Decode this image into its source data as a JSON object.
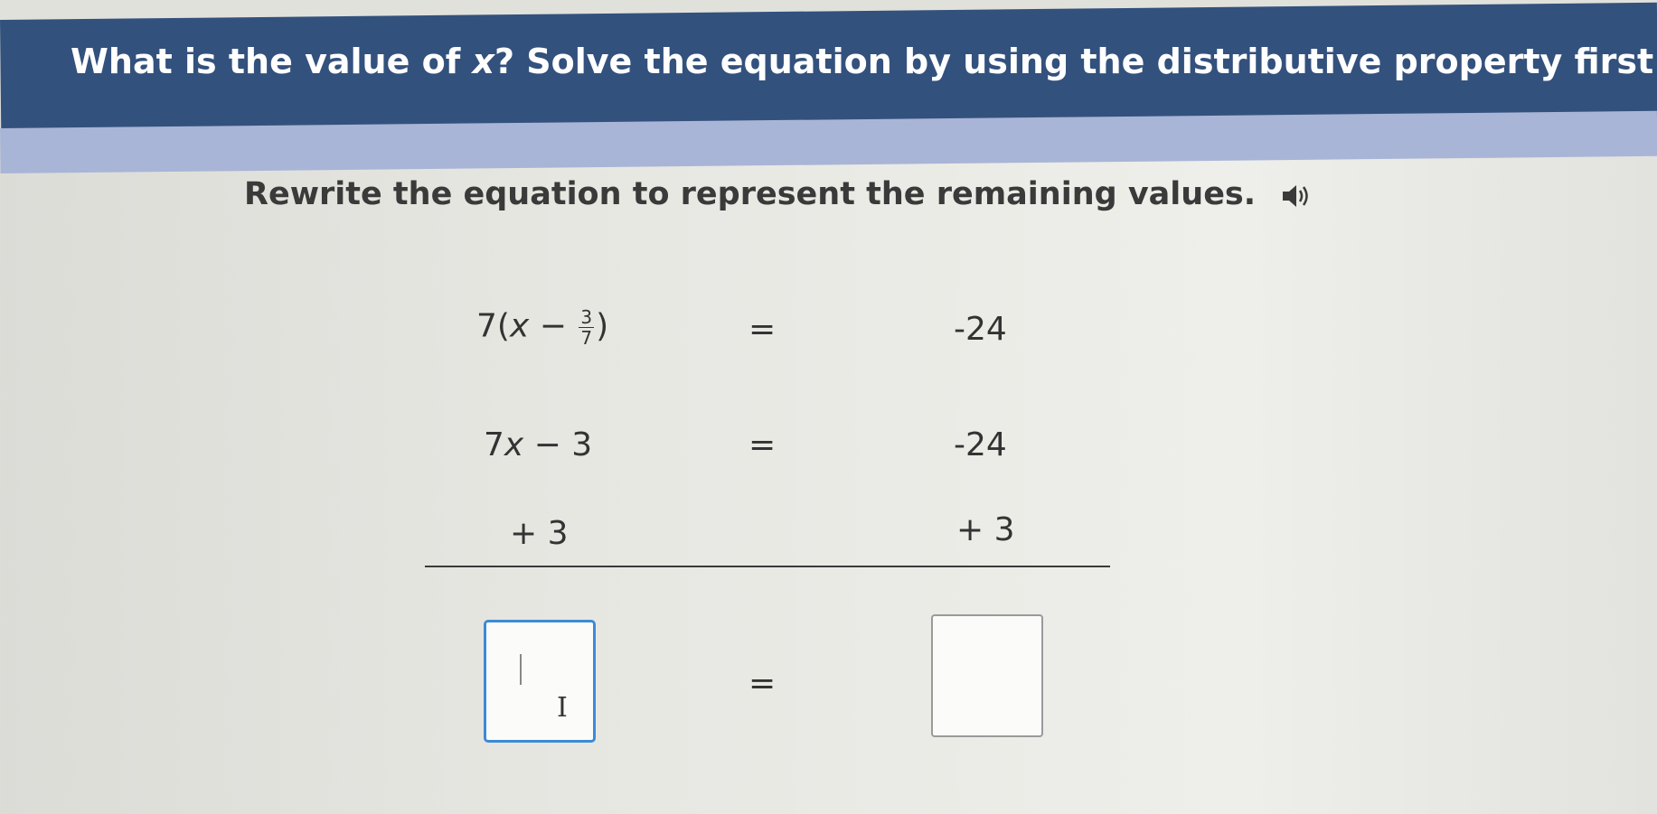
{
  "header": {
    "question_prefix": "What is the value of ",
    "question_var": "x",
    "question_suffix": "? Solve the equation by using the distributive property first.",
    "speaker_icon": "speaker-icon"
  },
  "instruction": {
    "text": "Rewrite the equation to represent the remaining values.",
    "speaker_icon": "speaker-icon"
  },
  "equation": {
    "row1": {
      "left_coef": "7(",
      "left_var": "x",
      "left_minus": " − ",
      "frac_num": "3",
      "frac_den": "7",
      "left_close": ")",
      "equals": "=",
      "right": "-24"
    },
    "row2": {
      "left_coef": "7",
      "left_var": "x",
      "left_rest": " − 3",
      "equals": "=",
      "right": "-24"
    },
    "row3": {
      "left": "+ 3",
      "right": "+ 3"
    },
    "row4": {
      "equals": "=",
      "left_answer": "",
      "right_answer": ""
    }
  },
  "colors": {
    "header_bg": "#33517d",
    "header_stripe": "#a9b5d6",
    "active_input_border": "#3d8ad6"
  }
}
